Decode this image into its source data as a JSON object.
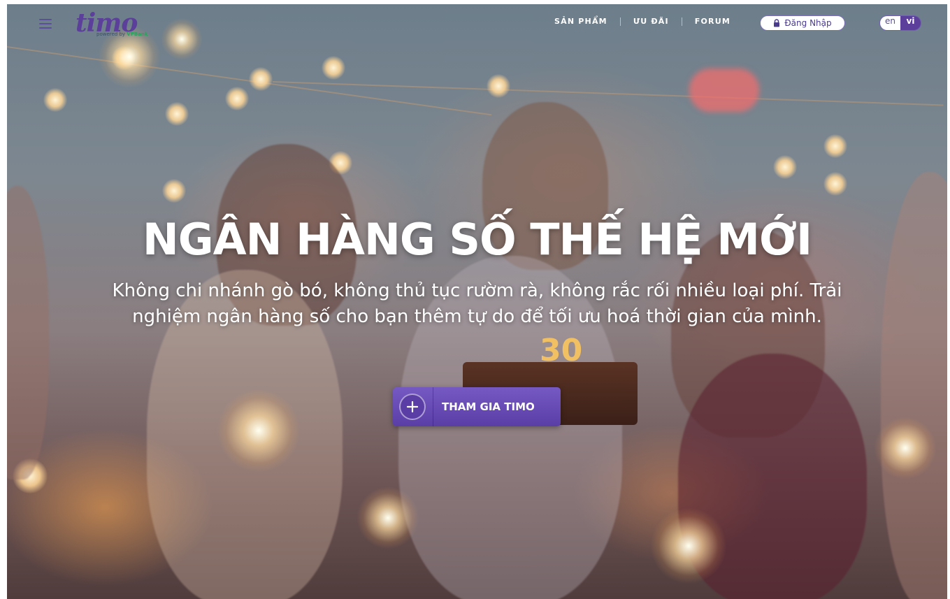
{
  "brand": {
    "logo_text": "timo",
    "logo_sub_prefix": "powered by",
    "logo_sub_bank": "VPBank"
  },
  "nav": {
    "items": [
      "SẢN PHẨM",
      "ƯU ĐÃI",
      "FORUM"
    ]
  },
  "login": {
    "label": "Đăng Nhập"
  },
  "language": {
    "options": [
      "en",
      "vi"
    ],
    "selected": "vi"
  },
  "hero": {
    "title": "NGÂN HÀNG SỐ THẾ HỆ MỚI",
    "subtitle": "Không chi nhánh gò bó, không thủ tục rườm rà, không rắc rối nhiều loại phí. Trải nghiệm ngân hàng số cho bạn thêm tự do để tối ưu hoá thời gian của mình.",
    "cta_label": "THAM GIA TIMO",
    "cake_number": "30"
  },
  "icons": [
    "menu-icon",
    "lock-icon",
    "plus-icon"
  ],
  "colors": {
    "brand_purple": "#5b3f9a",
    "button_purple": "#6a4fb8",
    "vpbank_green": "#27a35c"
  }
}
